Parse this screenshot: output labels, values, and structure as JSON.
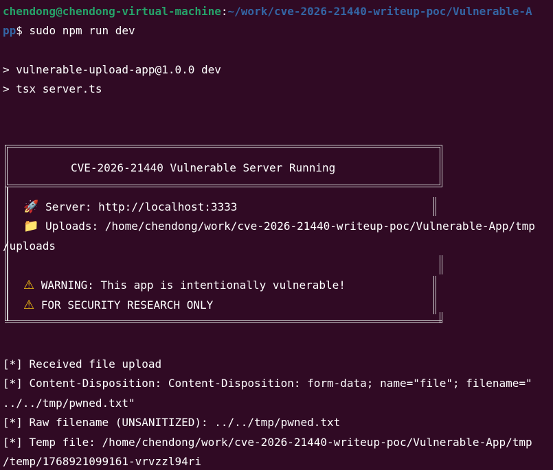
{
  "prompt": {
    "user_host": "chendong@chendong-virtual-machine",
    "colon": ":",
    "path_part1": "~/work/cve-2026-21440-writeup-poc/Vulnerable-A",
    "path_part2": "pp",
    "symbol": "$",
    "command": " sudo npm run dev"
  },
  "npm_output": {
    "line1": "> vulnerable-upload-app@1.0.0 dev",
    "line2": "> tsx server.ts"
  },
  "banner": {
    "title": "CVE-2026-21440 Vulnerable Server Running",
    "server_icon": "rocket-icon",
    "server_label": "Server: http://localhost:3333",
    "uploads_icon": "folder-icon",
    "uploads_label": "Uploads: /home/chendong/work/cve-2026-21440-writeup-poc/Vulnerable-App/tmp",
    "uploads_wrap": "/uploads",
    "warn_icon": "warning-icon",
    "warning_1": "WARNING: This app is intentionally vulnerable!",
    "warning_2": "FOR SECURITY RESEARCH ONLY"
  },
  "log": {
    "received": "[*] Received file upload",
    "content_disposition": "[*] Content-Disposition: Content-Disposition: form-data; name=\"file\"; filename=\"",
    "content_disposition_wrap": "../../tmp/pwned.txt\"",
    "raw_filename": "[*] Raw filename (UNSANITIZED): ../../tmp/pwned.txt",
    "temp_file": "[*] Temp file: /home/chendong/work/cve-2026-21440-writeup-poc/Vulnerable-App/tmp",
    "temp_file_wrap": "/temp/1768921099161-vrvzzl94ri"
  },
  "colors": {
    "background": "#300a24",
    "prompt_user": "#26a269",
    "prompt_path": "#3465a4",
    "text": "#ffffff"
  }
}
